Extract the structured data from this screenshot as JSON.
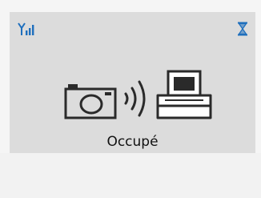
{
  "status": {
    "label": "Occupé",
    "signal_icon": "signal-strength-icon",
    "busy_icon": "hourglass-icon"
  },
  "illustration": {
    "source_icon": "camera-icon",
    "link_icon": "wireless-signal-icon",
    "target_icon": "printer-icon"
  },
  "colors": {
    "screen_bg": "#dcdcdc",
    "accent_blue": "#1f6fbd",
    "icon_stroke": "#2a2a2a"
  }
}
